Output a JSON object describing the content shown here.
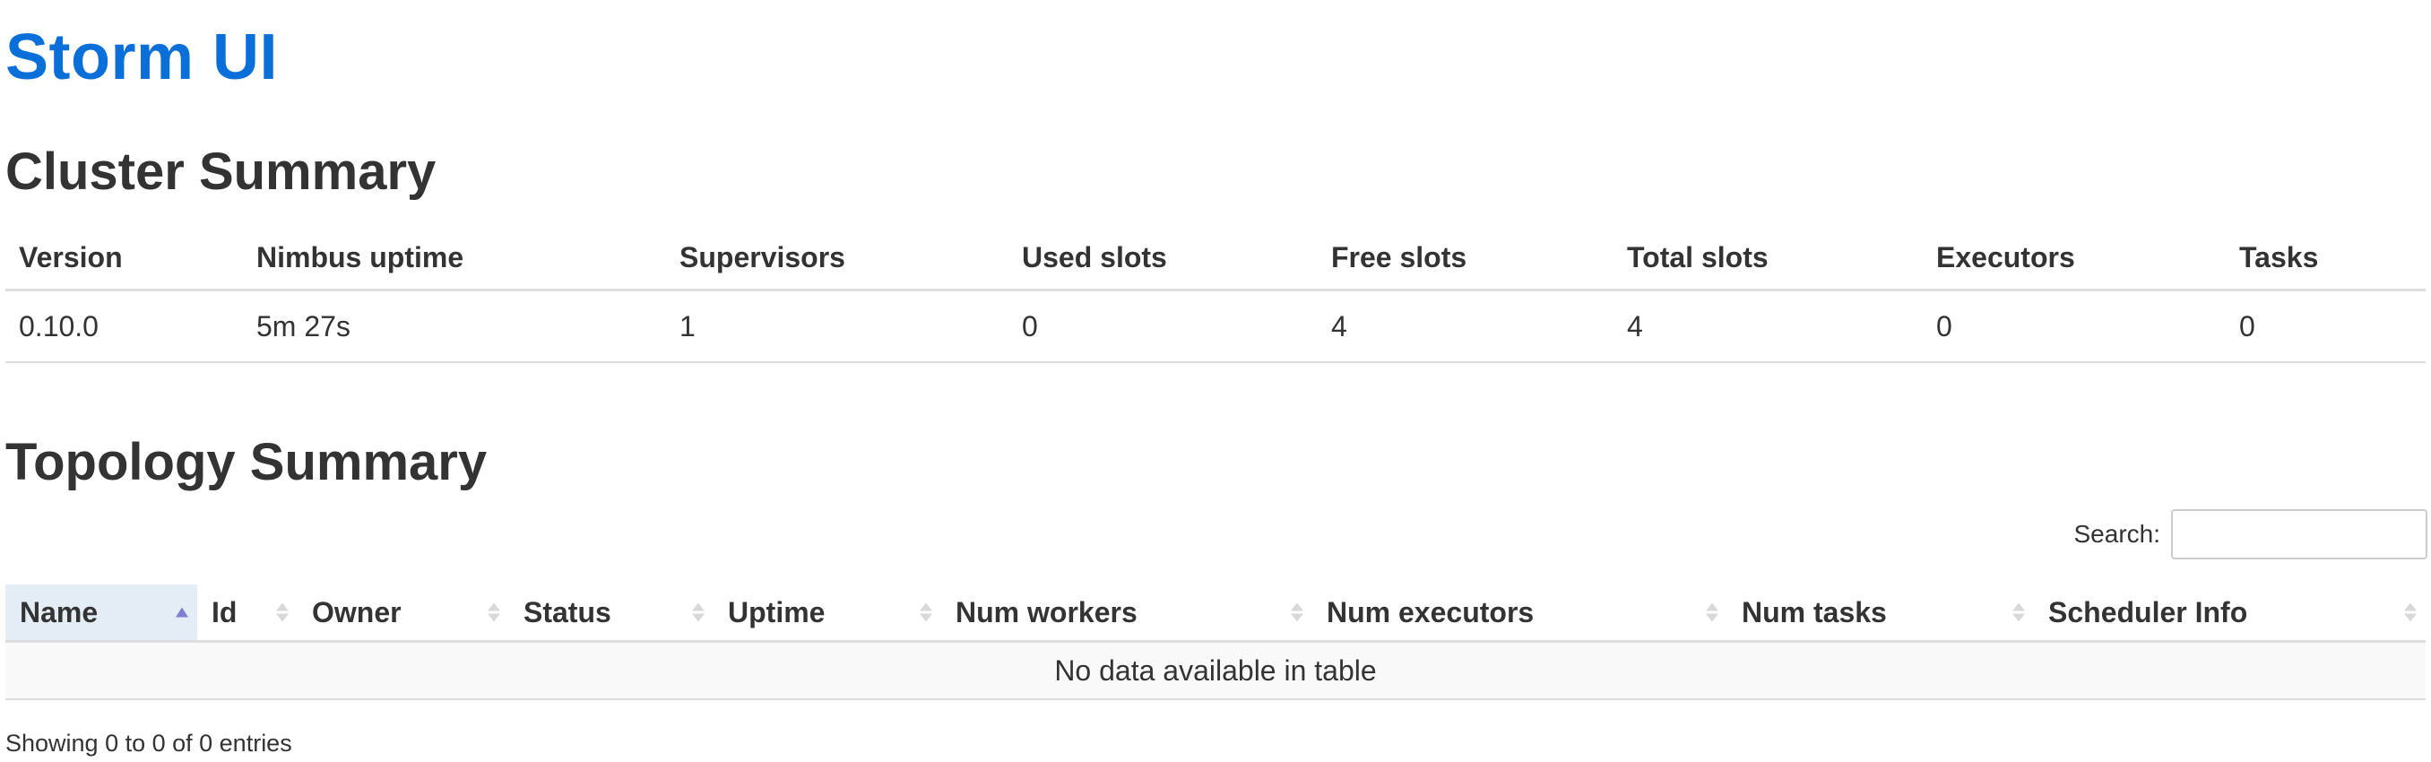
{
  "app": {
    "title": "Storm UI"
  },
  "cluster": {
    "title": "Cluster Summary",
    "columns": [
      "Version",
      "Nimbus uptime",
      "Supervisors",
      "Used slots",
      "Free slots",
      "Total slots",
      "Executors",
      "Tasks"
    ],
    "row": [
      "0.10.0",
      "5m 27s",
      "1",
      "0",
      "4",
      "4",
      "0",
      "0"
    ]
  },
  "topology": {
    "title": "Topology Summary",
    "search": {
      "label": "Search:",
      "value": "",
      "placeholder": ""
    },
    "columns": [
      "Name",
      "Id",
      "Owner",
      "Status",
      "Uptime",
      "Num workers",
      "Num executors",
      "Num tasks",
      "Scheduler Info"
    ],
    "sorted_column": "Name",
    "sort_direction": "ascending",
    "empty_message": "No data available in table",
    "info": "Showing 0 to 0 of 0 entries"
  },
  "colors": {
    "title_blue": "#0a6fd8",
    "sorted_header_bg": "#e4edf5",
    "sort_active": "#7d7fd2"
  },
  "icons": [
    "sort-ascending-icon",
    "sort-both-icon"
  ]
}
